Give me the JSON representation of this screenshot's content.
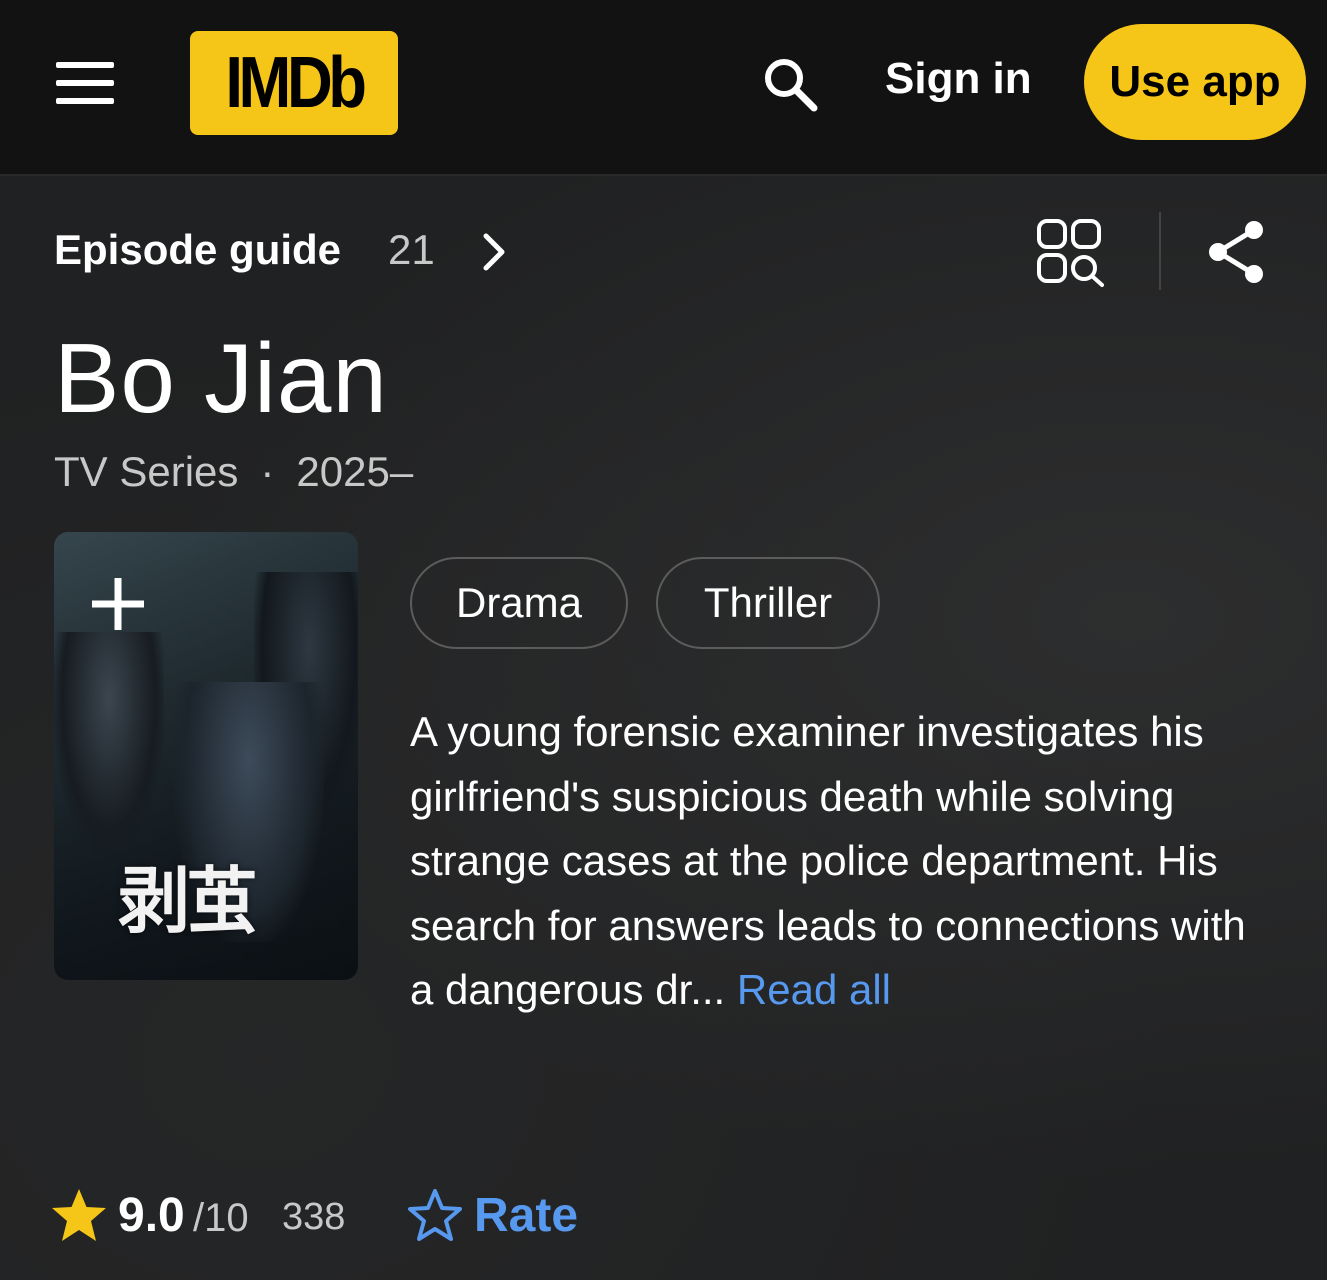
{
  "header": {
    "logo_text": "IMDb",
    "signin_label": "Sign in",
    "useapp_label": "Use app",
    "accent_color": "#f5c518"
  },
  "episode_guide": {
    "label": "Episode guide",
    "count": "21"
  },
  "title": {
    "name": "Bo Jian",
    "type": "TV Series",
    "separator": "·",
    "years": "2025–"
  },
  "poster": {
    "title_text": "剥茧"
  },
  "genres": [
    "Drama",
    "Thriller"
  ],
  "plot": {
    "text": "A young forensic examiner investigates his girlfriend's suspicious death while solving strange cases at the police department. His search for answers leads to connections with a dangerous dr...",
    "read_all_label": "Read all",
    "link_color": "#5799ef"
  },
  "rating": {
    "value": "9.0",
    "max": "/10",
    "count": "338",
    "rate_label": "Rate"
  }
}
